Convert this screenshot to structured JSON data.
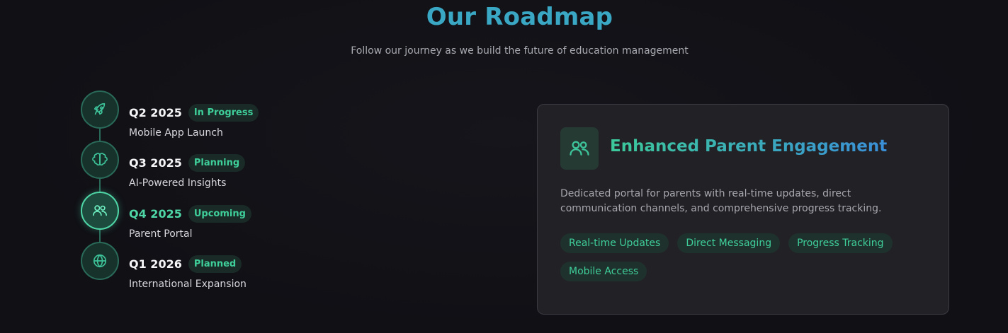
{
  "header": {
    "title": "Our Roadmap",
    "subtitle": "Follow our journey as we build the future of education management"
  },
  "timeline": [
    {
      "quarter": "Q2 2025",
      "status": "In Progress",
      "title": "Mobile App Launch",
      "icon": "rocket-icon",
      "active": false
    },
    {
      "quarter": "Q3 2025",
      "status": "Planning",
      "title": "AI-Powered Insights",
      "icon": "brain-icon",
      "active": false
    },
    {
      "quarter": "Q4 2025",
      "status": "Upcoming",
      "title": "Parent Portal",
      "icon": "users-icon",
      "active": true
    },
    {
      "quarter": "Q1 2026",
      "status": "Planned",
      "title": "International Expansion",
      "icon": "globe-icon",
      "active": false
    }
  ],
  "detail": {
    "icon": "users-icon",
    "title": "Enhanced Parent Engagement",
    "description": "Dedicated portal for parents with real-time updates, direct communication channels, and comprehensive progress tracking.",
    "tags": [
      "Real-time Updates",
      "Direct Messaging",
      "Progress Tracking",
      "Mobile Access"
    ]
  },
  "colors": {
    "accent": "#3fcf9b",
    "title": "#3aa8c4",
    "background": "#111116"
  }
}
